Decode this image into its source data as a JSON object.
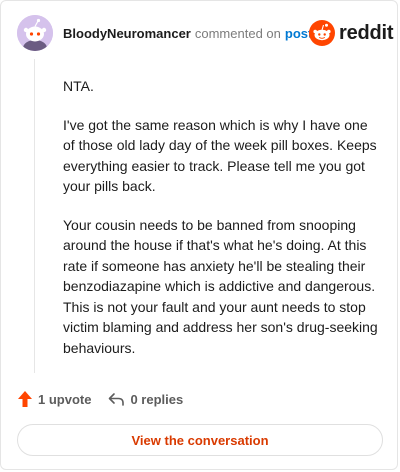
{
  "header": {
    "username": "BloodyNeuromancer",
    "commented_text": "commented on",
    "post_link": "post"
  },
  "brand": {
    "logo_text": "reddit",
    "brand_color": "#ff4500"
  },
  "comment": {
    "paragraphs": [
      "NTA.",
      "I've got the same reason which is why I have one of those old lady day of the week pill boxes. Keeps everything easier to track. Please tell me you got your pills back.",
      "Your cousin needs to be banned from snooping around the house if that's what he's doing. At this rate if someone has anxiety he'll be stealing their benzodiazapine which is addictive and dangerous. This is not your fault and your aunt needs to stop victim blaming and address her son's drug-seeking behaviours."
    ]
  },
  "actions": {
    "upvote_label": "1 upvote",
    "upvote_icon": "upvote-arrow-icon",
    "replies_label": "0 replies",
    "replies_icon": "reply-arrow-icon"
  },
  "cta": {
    "label": "View the conversation",
    "accent_color": "#d93a00"
  }
}
